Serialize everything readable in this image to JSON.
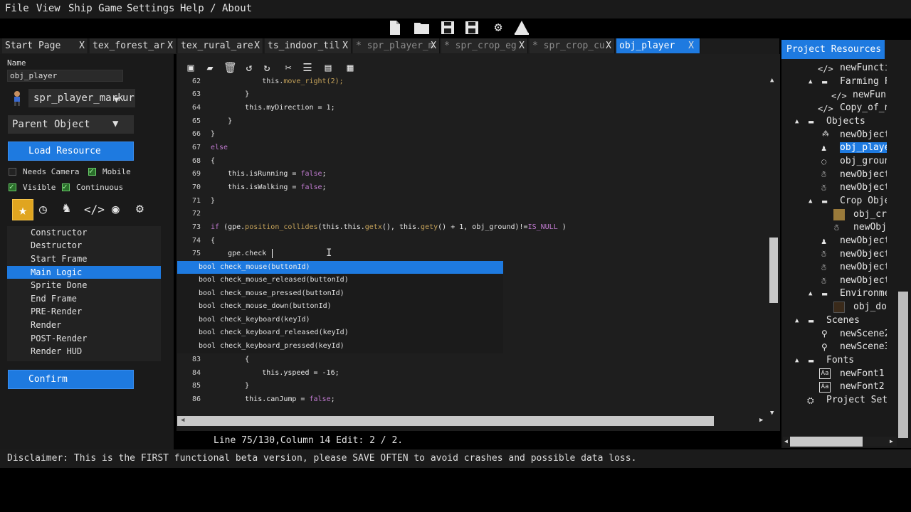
{
  "menu": [
    "File",
    "View",
    "Ship Game",
    "Settings",
    "Help / About"
  ],
  "tabs": [
    {
      "label": "Start Page",
      "close": "X"
    },
    {
      "label": "tex_forest_ar",
      "close": "X"
    },
    {
      "label": "tex_rural_are",
      "close": "X"
    },
    {
      "label": "ts_indoor_til",
      "close": "X"
    },
    {
      "label": "* spr_player_m",
      "close": "X"
    },
    {
      "label": "* spr_crop_eg",
      "close": "X"
    },
    {
      "label": "* spr_crop_cu",
      "close": "X"
    },
    {
      "label": "obj_player",
      "close": "X"
    }
  ],
  "left": {
    "name_label": "Name",
    "name_value": "obj_player",
    "sprite_dropdown": "spr_player_mark",
    "sprite_dropdown_trunc": "ur",
    "parent_dropdown": "Parent Object",
    "load_resource": "Load Resource",
    "needs_camera": "Needs Camera",
    "mobile": "Mobile",
    "visible": "Visible",
    "continuous": "Continuous",
    "events": [
      "Constructor",
      "Destructor",
      "Start Frame",
      "Main Logic",
      "Sprite Done",
      "End Frame",
      "PRE-Render",
      "Render",
      "POST-Render",
      "Render HUD"
    ],
    "confirm": "Confirm"
  },
  "code": {
    "lines": [
      {
        "n": "62",
        "text": "            this.move_right(2);"
      },
      {
        "n": "63",
        "text": "        }"
      },
      {
        "n": "64",
        "text": "        this.myDirection = 1;"
      },
      {
        "n": "65",
        "text": "    }"
      },
      {
        "n": "66",
        "text": "}"
      },
      {
        "n": "67",
        "text": "else"
      },
      {
        "n": "68",
        "text": "{"
      },
      {
        "n": "69",
        "text": "    this.isRunning = false;"
      },
      {
        "n": "70",
        "text": "    this.isWalking = false;"
      },
      {
        "n": "71",
        "text": "}"
      },
      {
        "n": "72",
        "text": ""
      },
      {
        "n": "73",
        "text": "if (gpe.position_collides(this.this.getx(), this.gety() + 1, obj_ground)!=IS_NULL )"
      },
      {
        "n": "74",
        "text": "{"
      },
      {
        "n": "75",
        "text": "    gpe.check"
      },
      {
        "n": "83",
        "text": "        {"
      },
      {
        "n": "84",
        "text": "            this.yspeed = -16;"
      },
      {
        "n": "85",
        "text": "        }"
      },
      {
        "n": "86",
        "text": "        this.canJump = false;"
      }
    ],
    "autocomplete": [
      "bool check_mouse(buttonId)",
      "bool check_mouse_released(buttonId)",
      "bool check_mouse_pressed(buttonId)",
      "bool check_mouse_down(buttonId)",
      "bool check_keyboard(keyId)",
      "bool check_keyboard_released(keyId)",
      "bool check_keyboard_pressed(keyId)"
    ],
    "status": "Line 75/130,Column 14 Edit: 2 / 2."
  },
  "disclaimer": "Disclaimer: This is the FIRST functional beta version, please SAVE OFTEN to avoid crashes and possible data loss.",
  "resources": {
    "title": "Project Resources",
    "items": [
      {
        "label": "newFuncti",
        "icon": "</>"
      },
      {
        "label": "Farming F",
        "icon": "▪"
      },
      {
        "label": "newFunc",
        "icon": "</>"
      },
      {
        "label": "Copy_of_n",
        "icon": "</>"
      },
      {
        "label": "Objects",
        "icon": "▪"
      },
      {
        "label": "newObject",
        "icon": ""
      },
      {
        "label": "obj_playe",
        "icon": ""
      },
      {
        "label": "obj_groun",
        "icon": ""
      },
      {
        "label": "newObject",
        "icon": ""
      },
      {
        "label": "newObject",
        "icon": ""
      },
      {
        "label": "Crop Obje",
        "icon": "▪"
      },
      {
        "label": "obj_cro",
        "icon": ""
      },
      {
        "label": "newObje",
        "icon": ""
      },
      {
        "label": "newObject",
        "icon": ""
      },
      {
        "label": "newObject",
        "icon": ""
      },
      {
        "label": "newObject",
        "icon": ""
      },
      {
        "label": "newObject",
        "icon": ""
      },
      {
        "label": "Environme",
        "icon": "▪"
      },
      {
        "label": "obj_doc",
        "icon": ""
      },
      {
        "label": "Scenes",
        "icon": "▪"
      },
      {
        "label": "newScene2",
        "icon": ""
      },
      {
        "label": "newScene3",
        "icon": ""
      },
      {
        "label": "Fonts",
        "icon": "▪"
      },
      {
        "label": "newFont1",
        "icon": ""
      },
      {
        "label": "newFont2",
        "icon": ""
      },
      {
        "label": "Project Setti",
        "icon": ""
      }
    ]
  }
}
